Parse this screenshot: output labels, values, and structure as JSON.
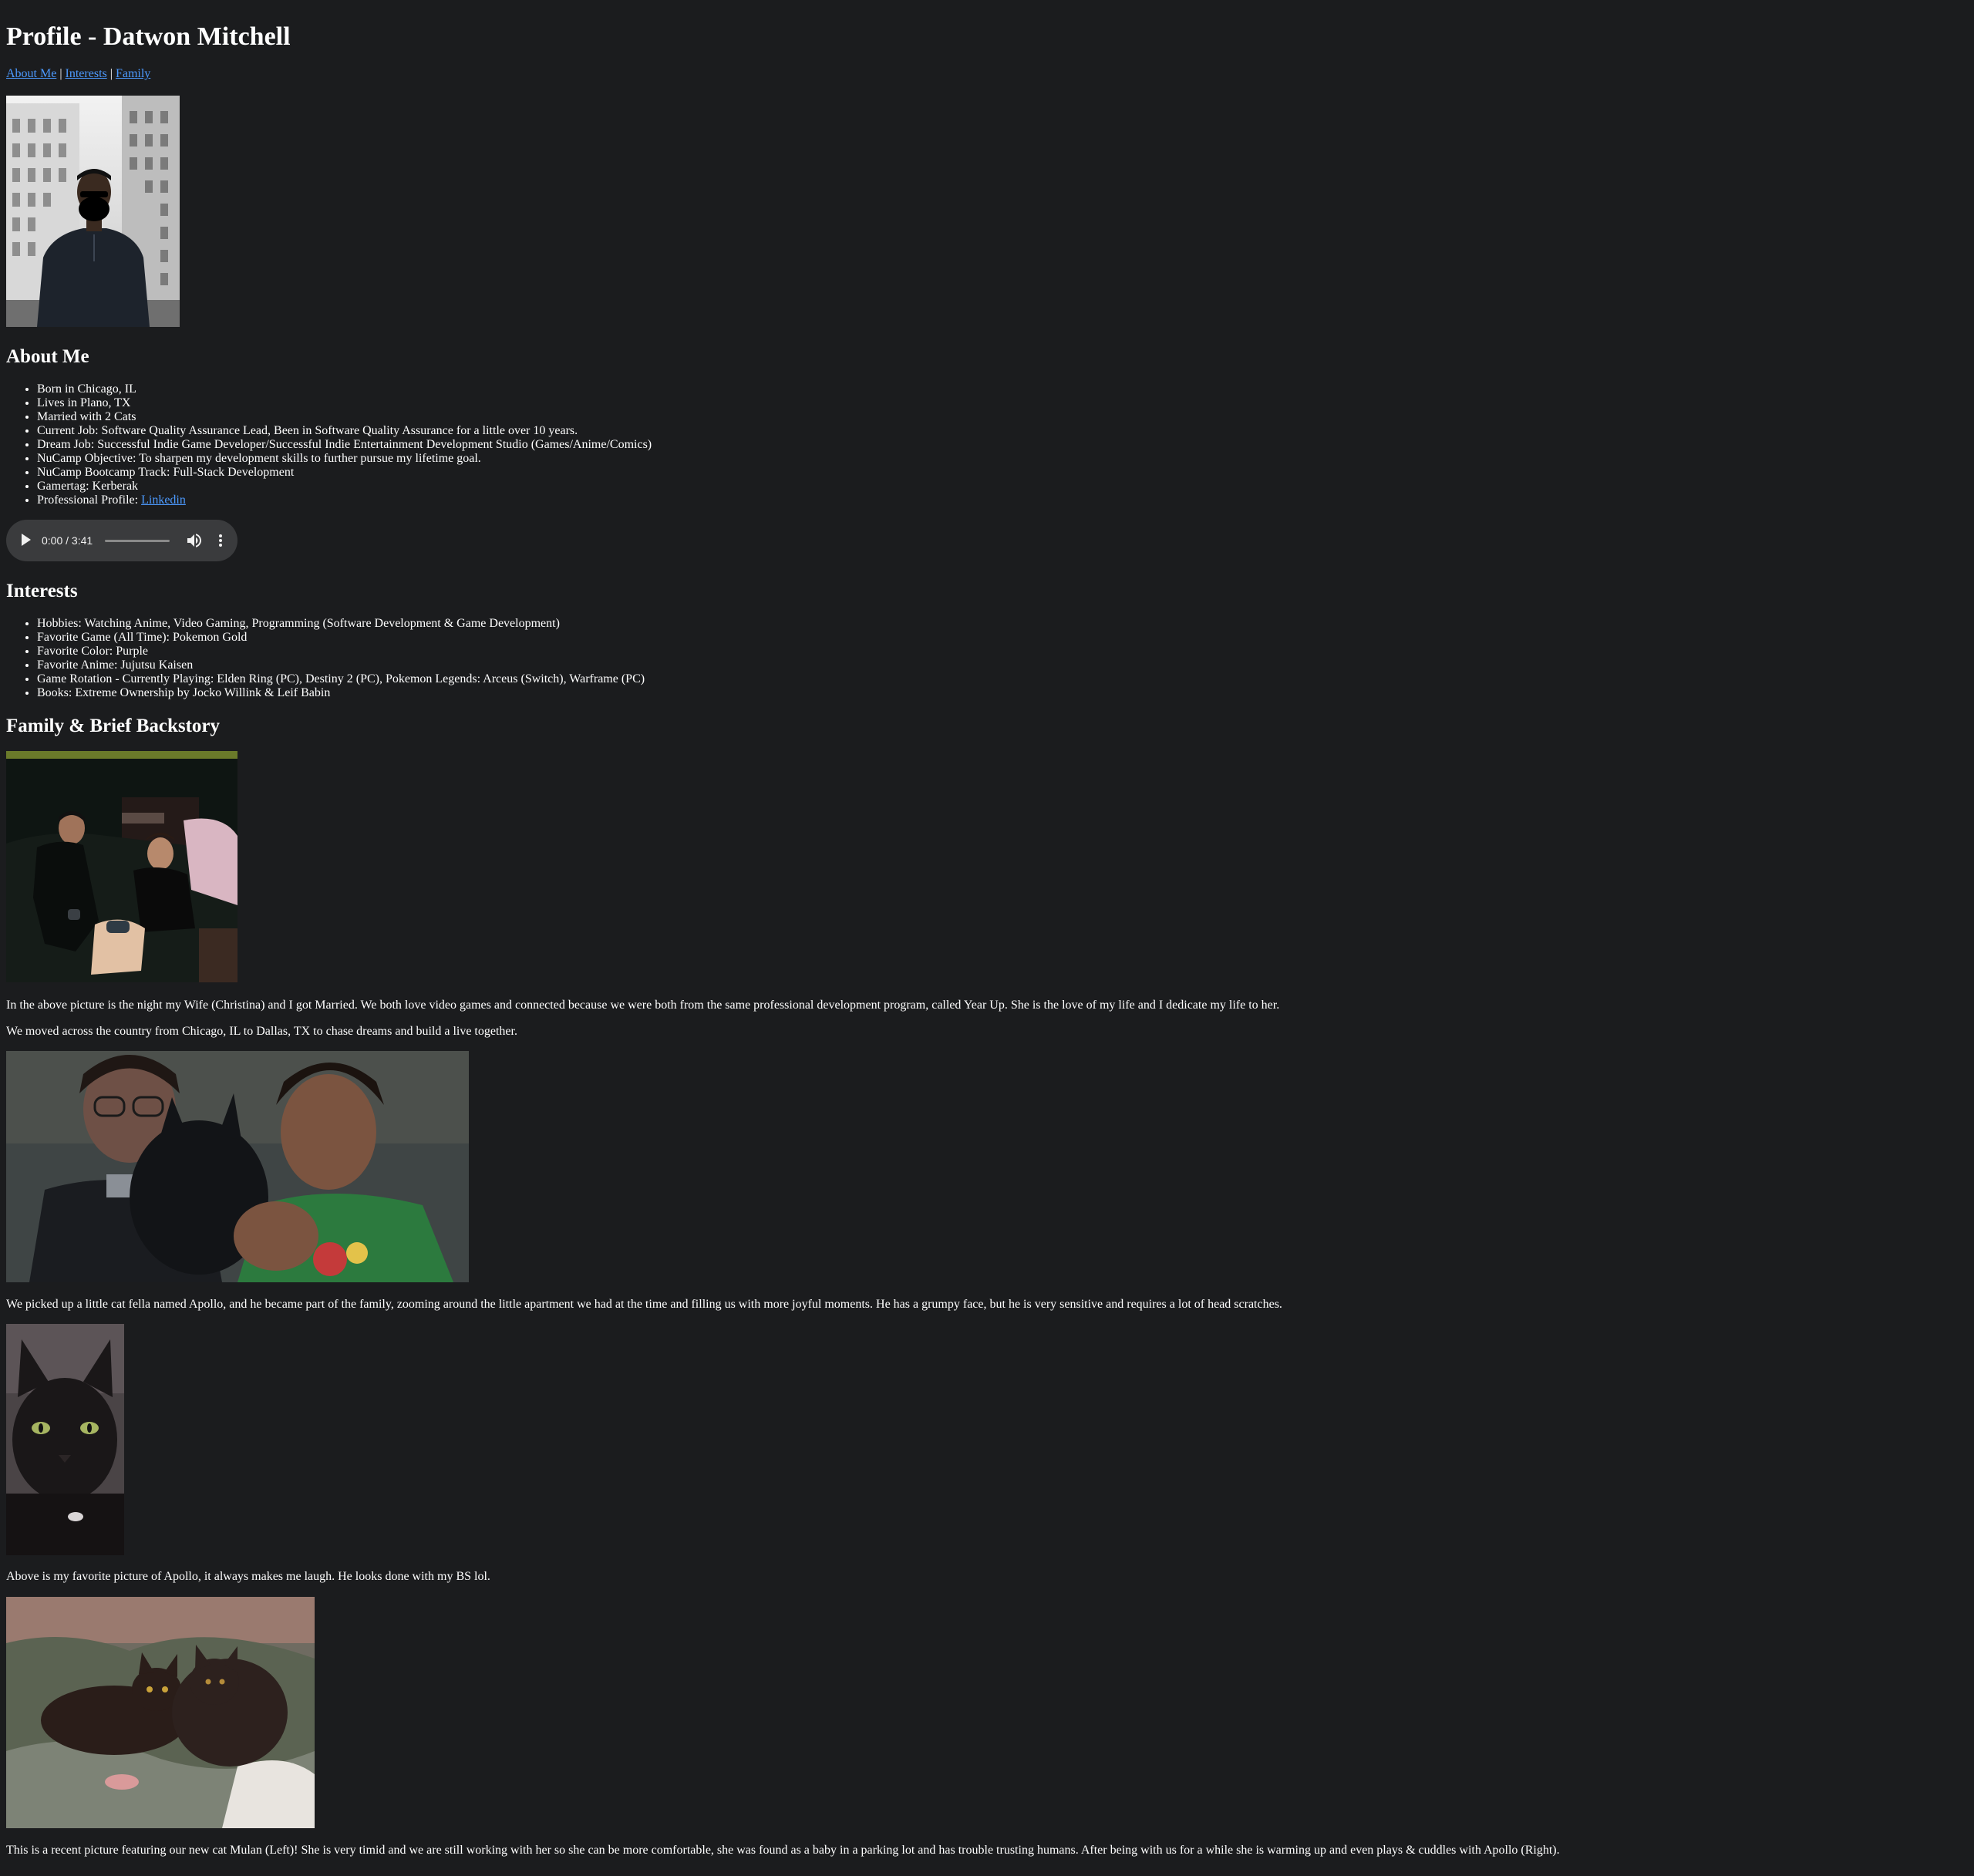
{
  "page": {
    "title": "Profile - Datwon Mitchell",
    "background": "#1b1c1e",
    "link_color": "#4c9aff"
  },
  "nav": {
    "links": [
      "About Me",
      "Interests",
      "Family"
    ],
    "separator": "|"
  },
  "about": {
    "heading": "About Me",
    "items": [
      "Born in Chicago, IL",
      "Lives in Plano, TX",
      "Married with 2 Cats",
      "Current Job: Software Quality Assurance Lead, Been in Software Quality Assurance for a little over 10 years.",
      "Dream Job: Successful Indie Game Developer/Successful Indie Entertainment Development Studio (Games/Anime/Comics)",
      "NuCamp Objective: To sharpen my development skills to further pursue my lifetime goal.",
      "NuCamp Bootcamp Track: Full-Stack Development",
      "Gamertag: Kerberak"
    ],
    "professional_label": "Professional Profile: ",
    "professional_link": "Linkedin"
  },
  "audio": {
    "time": "0:00 / 3:41",
    "progress": 0,
    "icons": [
      "play-icon",
      "volume-icon",
      "more-options-icon"
    ]
  },
  "interests": {
    "heading": "Interests",
    "items": [
      "Hobbies: Watching Anime, Video Gaming, Programming (Software Development & Game Development)",
      "Favorite Game (All Time): Pokemon Gold",
      "Favorite Color: Purple",
      "Favorite Anime: Jujutsu Kaisen",
      "Game Rotation - Currently Playing: Elden Ring (PC), Destiny 2 (PC), Pokemon Legends: Arceus (Switch), Warframe (PC)",
      "Books: Extreme Ownership by Jocko Willink & Leif Babin"
    ]
  },
  "family": {
    "heading": "Family & Brief Backstory",
    "paragraphs": [
      "In the above picture is the night my Wife (Christina) and I got Married. We both love video games and connected because we were both from the same professional development program, called Year Up. She is the love of my life and I dedicate my life to her.",
      "We moved across the country from Chicago, IL to Dallas, TX to chase dreams and build a live together.",
      "We picked up a little cat fella named Apollo, and he became part of the family, zooming around the little apartment we had at the time and filling us with more joyful moments. He has a grumpy face, but he is very sensitive and requires a lot of head scratches.",
      "Above is my favorite picture of Apollo, it always makes me laugh. He looks done with my BS lol.",
      "This is a recent picture featuring our new cat Mulan (Left)! She is very timid and we are still working with her so she can be more comfortable, she was found as a baby in a parking lot and has trouble trusting humans. After being with us for a while she is warming up and even plays & cuddles with Apollo (Right)."
    ]
  }
}
